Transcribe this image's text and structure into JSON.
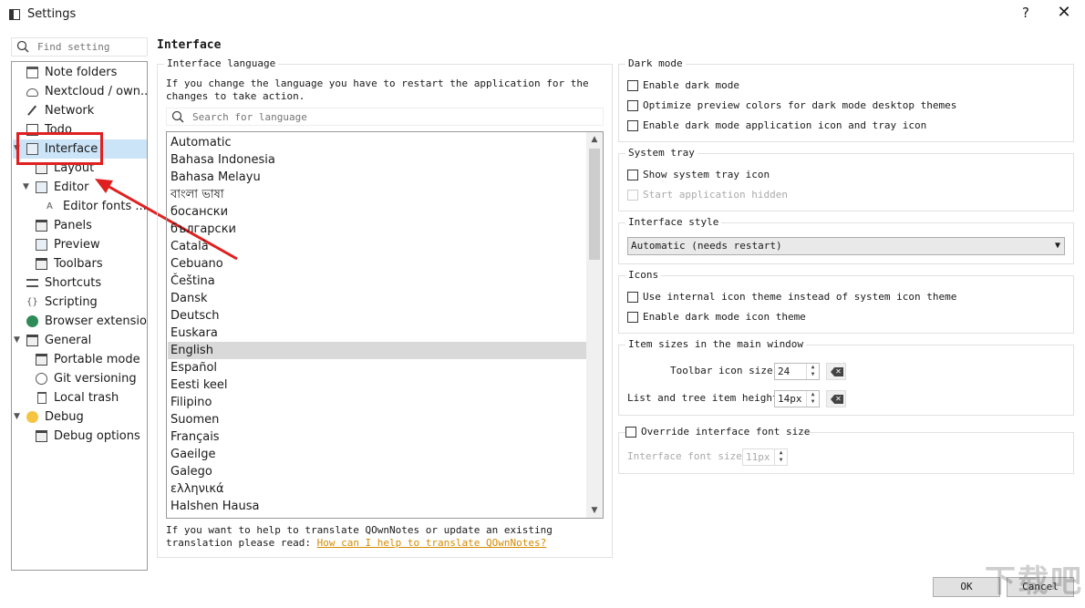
{
  "window": {
    "title": "Settings",
    "help_glyph": "?",
    "close_glyph": "✕"
  },
  "sidebar": {
    "search_placeholder": "Find setting",
    "items": [
      {
        "label": "Note folders"
      },
      {
        "label": "Nextcloud / own..."
      },
      {
        "label": "Network"
      },
      {
        "label": "Todo"
      },
      {
        "label": "Interface"
      },
      {
        "label": "Layout"
      },
      {
        "label": "Editor"
      },
      {
        "label": "Editor fonts ..."
      },
      {
        "label": "Panels"
      },
      {
        "label": "Preview"
      },
      {
        "label": "Toolbars"
      },
      {
        "label": "Shortcuts"
      },
      {
        "label": "Scripting"
      },
      {
        "label": "Browser extension"
      },
      {
        "label": "General"
      },
      {
        "label": "Portable mode"
      },
      {
        "label": "Git versioning"
      },
      {
        "label": "Local trash"
      },
      {
        "label": "Debug"
      },
      {
        "label": "Debug options"
      }
    ]
  },
  "main": {
    "heading": "Interface",
    "language": {
      "group_title": "Interface language",
      "description": "If you change the language you have to restart the application for the changes to take action.",
      "search_placeholder": "Search for language",
      "languages": [
        "Automatic",
        "Bahasa Indonesia",
        "Bahasa Melayu",
        "বাংলা ভাষা",
        "босански",
        "български",
        "Català",
        "Cebuano",
        "Čeština",
        "Dansk",
        "Deutsch",
        "Euskara",
        "English",
        "Español",
        "Eesti keel",
        "Filipino",
        "Suomen",
        "Français",
        "Gaeilge",
        "Galego",
        "ελληνικά",
        "Halshen Hausa"
      ],
      "selected": "English",
      "help_text": "If you want to help to translate QOwnNotes or update an existing translation please read:",
      "help_link": "How can I help to translate QOwnNotes?"
    },
    "dark_mode": {
      "group_title": "Dark mode",
      "options": [
        "Enable dark mode",
        "Optimize preview colors for dark mode desktop themes",
        "Enable dark mode application icon and tray icon"
      ]
    },
    "system_tray": {
      "group_title": "System tray",
      "options": [
        "Show system tray icon",
        "Start application hidden"
      ]
    },
    "interface_style": {
      "group_title": "Interface style",
      "value": "Automatic (needs restart)"
    },
    "icons": {
      "group_title": "Icons",
      "options": [
        "Use internal icon theme instead of system icon theme",
        "Enable dark mode icon theme"
      ]
    },
    "item_sizes": {
      "group_title": "Item sizes in the main window",
      "toolbar_label": "Toolbar icon size:",
      "toolbar_value": "24",
      "tree_label": "List and tree item height:",
      "tree_value": "14px"
    },
    "font_size": {
      "group_title": "Override interface font size",
      "label": "Interface font size:",
      "value": "11px"
    }
  },
  "footer": {
    "ok_label": "OK",
    "cancel_label": "Cancel"
  },
  "watermark": "下载吧",
  "colors": {
    "selection": "#cce4f7",
    "annotation": "#e02020",
    "link": "#d58a00"
  }
}
